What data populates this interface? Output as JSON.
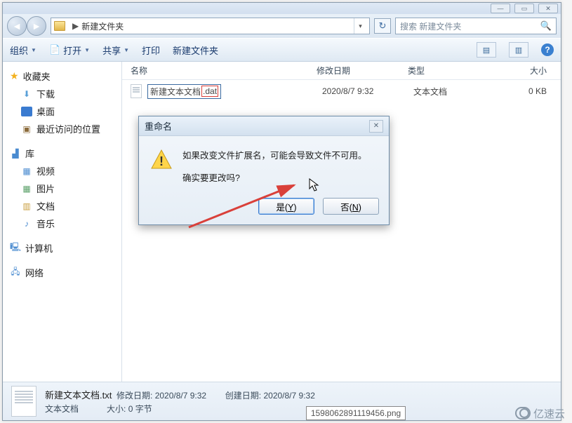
{
  "window": {
    "min": "—",
    "max": "▭",
    "close": "✕"
  },
  "address": {
    "folder_name": "新建文件夹",
    "separator": "▶",
    "dropdown": "▾",
    "refresh": "↻"
  },
  "search": {
    "placeholder": "搜索 新建文件夹",
    "icon": "🔍"
  },
  "toolbar": {
    "organize": "组织",
    "open": "打开",
    "share": "共享",
    "print": "打印",
    "new_folder": "新建文件夹",
    "view_icon": "▤",
    "help": "?"
  },
  "sidebar": {
    "favorites": "收藏夹",
    "downloads": "下载",
    "desktop": "桌面",
    "recent": "最近访问的位置",
    "libraries": "库",
    "videos": "视频",
    "pictures": "图片",
    "documents": "文档",
    "music": "音乐",
    "computer": "计算机",
    "network": "网络"
  },
  "columns": {
    "name": "名称",
    "date": "修改日期",
    "type": "类型",
    "size": "大小"
  },
  "file": {
    "base": "新建文本文档",
    "ext": ".dat",
    "date": "2020/8/7 9:32",
    "type": "文本文档",
    "size": "0 KB"
  },
  "dialog": {
    "title": "重命名",
    "message": "如果改变文件扩展名，可能会导致文件不可用。",
    "question": "确实要更改吗?",
    "yes": "是(Y)",
    "no": "否(N)",
    "close": "✕"
  },
  "details": {
    "filename": "新建文本文档.txt",
    "mod_label": "修改日期:",
    "mod_value": "2020/8/7 9:32",
    "create_label": "创建日期:",
    "create_value": "2020/8/7 9:32",
    "type_label": "文本文档",
    "size_label": "大小:",
    "size_value": "0 字节"
  },
  "footer": {
    "image_name": "1598062891119456.png",
    "logo_text": "亿速云"
  }
}
